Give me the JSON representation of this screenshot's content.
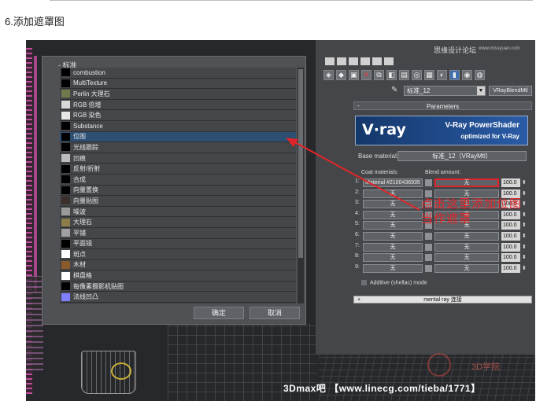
{
  "page": {
    "step_title": "6.添加遮罩图"
  },
  "browser": {
    "header": "- 标准",
    "items": [
      {
        "label": "combustion",
        "color": "#000000"
      },
      {
        "label": "MultiTexture",
        "color": "#000000"
      },
      {
        "label": "Perlin 大理石",
        "color": "#6e7a4a"
      },
      {
        "label": "RGB 倍增",
        "color": "#d8d8d8"
      },
      {
        "label": "RGB 染色",
        "color": "#e6e6e6"
      },
      {
        "label": "Substance",
        "color": "#000000"
      },
      {
        "label": "位图",
        "color": "#000000",
        "selected": true
      },
      {
        "label": "光线跟踪",
        "color": "#000000"
      },
      {
        "label": "凹痕",
        "color": "#bcbcbc"
      },
      {
        "label": "反射/折射",
        "color": "#000000"
      },
      {
        "label": "合成",
        "color": "#000000"
      },
      {
        "label": "向量置换",
        "color": "#000000"
      },
      {
        "label": "向量贴图",
        "color": "#3a2f2a"
      },
      {
        "label": "噪波",
        "color": "#9a9a9a"
      },
      {
        "label": "大理石",
        "color": "#8c7d4a"
      },
      {
        "label": "平铺",
        "color": "#a0a0a0"
      },
      {
        "label": "平面镜",
        "color": "#000000"
      },
      {
        "label": "斑点",
        "color": "#ffffff"
      },
      {
        "label": "木材",
        "color": "#8a5a2a"
      },
      {
        "label": "棋盘格",
        "color": "#ffffff"
      },
      {
        "label": "每像素摄影机贴图",
        "color": "#000000"
      },
      {
        "label": "法线凹凸",
        "color": "#7f7fff"
      }
    ],
    "ok_label": "确定",
    "cancel_label": "取消"
  },
  "editor": {
    "material_name": "标准_12",
    "material_type": "VRayBlendMtl",
    "params_title": "Parameters",
    "banner_logo": "V·ray",
    "banner_title": "V-Ray PowerShader",
    "banner_subtitle": "optimized for V-Ray",
    "base_material_label": "Base material:",
    "base_material_value": "标准_12（VRayMtl）",
    "coat_header": "Coat materials:",
    "blend_header": "Blend amount:",
    "coats": [
      {
        "num": "1:",
        "material": "Material #2100436935",
        "mask": "无",
        "amount": "100.0",
        "highlight": true
      },
      {
        "num": "2:",
        "material": "无",
        "mask": "无",
        "amount": "100.0"
      },
      {
        "num": "3:",
        "material": "无",
        "mask": "无",
        "amount": "100.0"
      },
      {
        "num": "4:",
        "material": "无",
        "mask": "无",
        "amount": "100.0"
      },
      {
        "num": "5:",
        "material": "无",
        "mask": "无",
        "amount": "100.0"
      },
      {
        "num": "6:",
        "material": "无",
        "mask": "无",
        "amount": "100.0"
      },
      {
        "num": "7:",
        "material": "无",
        "mask": "无",
        "amount": "100.0"
      },
      {
        "num": "8:",
        "material": "无",
        "mask": "无",
        "amount": "100.0"
      },
      {
        "num": "9:",
        "material": "无",
        "mask": "无",
        "amount": "100.0"
      }
    ],
    "additive_label": "Additive (shellac) mode",
    "mentalray_label": "mental ray 连接",
    "mentalray_toggle": "+"
  },
  "annotation": {
    "text": "点击这里添加位图当作遮罩",
    "color": "#e0252a"
  },
  "watermarks": {
    "top_right": "思缘设计论坛",
    "top_right_url": "www.missyuan.com",
    "footer": "3Dmax吧 【www.linecg.com/tieba/1771】",
    "seal": "3D学院"
  }
}
